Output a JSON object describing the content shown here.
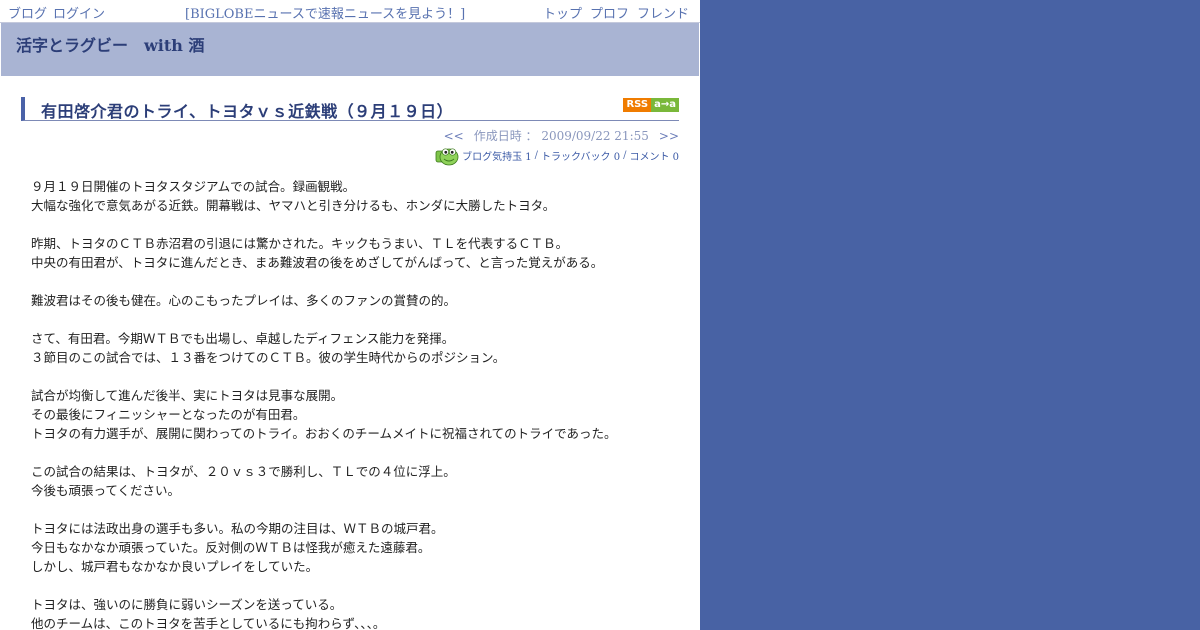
{
  "topbar": {
    "blog_link": "ブログ",
    "login_link": "ログイン",
    "banner": "[BIGLOBEニュースで速報ニュースを見よう！]",
    "nav": [
      "トップ",
      "プロフ",
      "フレンド"
    ]
  },
  "blog": {
    "title": "活字とラグビー　with 酒"
  },
  "entry": {
    "title": "有田啓介君のトライ、トヨタｖｓ近鉄戦（９月１９日）",
    "rss_label": "RSS",
    "aa_label": "a→a",
    "prev": "<<",
    "created_label": "作成日時 ： 2009/09/22 21:55",
    "next": ">>",
    "stats": {
      "kimochi": "ブログ気持玉 1",
      "trackback": "トラックバック 0",
      "comment": "コメント 0"
    },
    "lines": [
      "９月１９日開催のトヨタスタジアムでの試合。録画観戦。",
      "大幅な強化で意気あがる近鉄。開幕戦は、ヤマハと引き分けるも、ホンダに大勝したトヨタ。",
      "",
      "昨期、トヨタのＣＴＢ赤沼君の引退には驚かされた。キックもうまい、ＴＬを代表するＣＴＢ。",
      "中央の有田君が、トヨタに進んだとき、まあ難波君の後をめざしてがんばって、と言った覚えがある。",
      "",
      "難波君はその後も健在。心のこもったプレイは、多くのファンの賞賛の的。",
      "",
      "さて、有田君。今期ＷＴＢでも出場し、卓越したディフェンス能力を発揮。",
      "３節目のこの試合では、１３番をつけてのＣＴＢ。彼の学生時代からのポジション。",
      "",
      "試合が均衡して進んだ後半、実にトヨタは見事な展開。",
      "その最後にフィニッシャーとなったのが有田君。",
      "トヨタの有力選手が、展開に関わってのトライ。おおくのチームメイトに祝福されてのトライであった。",
      "",
      "この試合の結果は、トヨタが、２０ｖｓ３で勝利し、ＴＬでの４位に浮上。",
      "今後も頑張ってください。",
      "",
      "トヨタには法政出身の選手も多い。私の今期の注目は、ＷＴＢの城戸君。",
      "今日もなかなか頑張っていた。反対側のＷＴＢは怪我が癒えた遠藤君。",
      "しかし、城戸君もなかなか良いプレイをしていた。",
      "",
      "トヨタは、強いのに勝負に弱いシーズンを送っている。",
      "他のチームは、このトヨタを苦手としているにも拘わらず、、、。"
    ]
  },
  "colors": {
    "background": "#4862a4",
    "header": "#a9b4d3",
    "title_text": "#2c3e78",
    "link": "#5872b0"
  }
}
